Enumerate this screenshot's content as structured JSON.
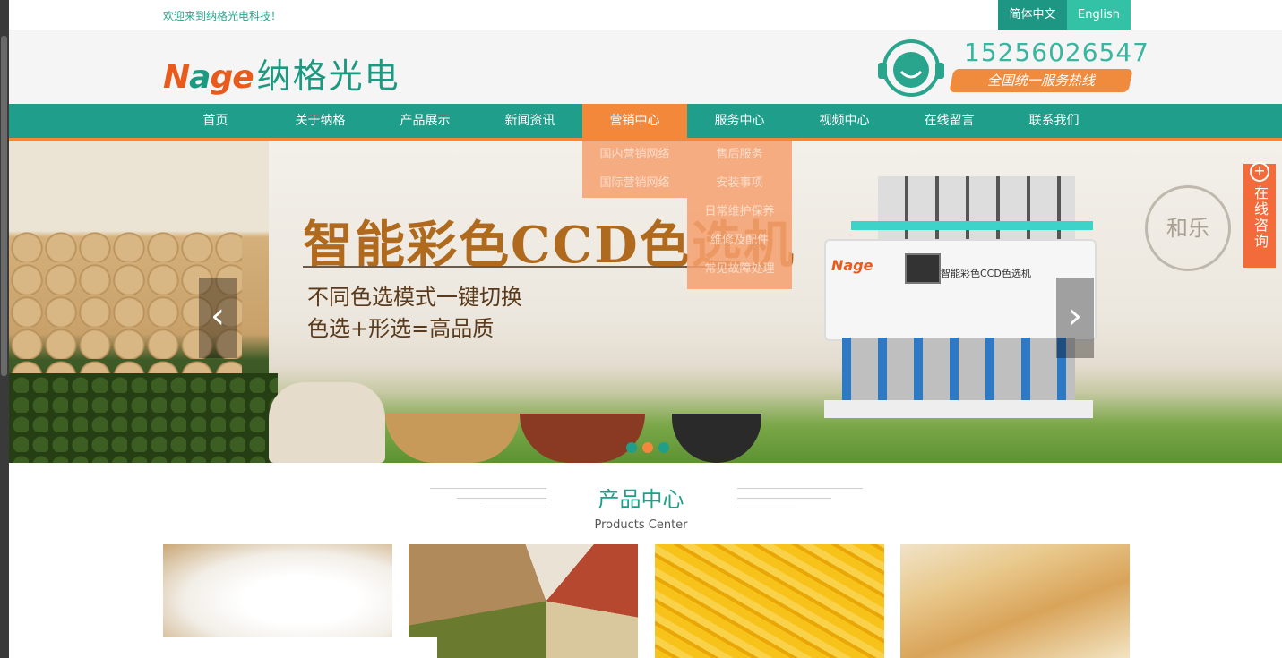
{
  "topbar": {
    "welcome": "欢迎来到纳格光电科技！",
    "lang_cn": "简体中文",
    "lang_en": "English"
  },
  "header": {
    "logo_en_n": "N",
    "logo_en_a": "a",
    "logo_en_ge": "ge",
    "logo_cn": "纳格光电",
    "phone": "15256026547",
    "hotline_label": "全国统一服务热线"
  },
  "nav": {
    "items": [
      {
        "label": "首页"
      },
      {
        "label": "关于纳格"
      },
      {
        "label": "产品展示"
      },
      {
        "label": "新闻资讯"
      },
      {
        "label": "营销中心"
      },
      {
        "label": "服务中心"
      },
      {
        "label": "视频中心"
      },
      {
        "label": "在线留言"
      },
      {
        "label": "联系我们"
      }
    ],
    "active_index": 4,
    "dropdown_marketing": [
      "国内营销网络",
      "国际营销网络"
    ],
    "dropdown_service": [
      "售后服务",
      "安装事项",
      "日常维护保养",
      "维修及配件",
      "常见故障处理"
    ]
  },
  "banner": {
    "headline": "智能彩色CCD色选机",
    "sub1": "不同色选模式一键切换",
    "sub2": "色选+形选=高品质",
    "machine_brand": "Nage",
    "machine_label": "智能彩色CCD色选机",
    "prev_arrow": "‹",
    "next_arrow": "›",
    "seal_text": "和乐",
    "dots": 3,
    "active_dot": 1
  },
  "consult": {
    "plus": "+",
    "label": "在线咨询"
  },
  "products_section": {
    "title": "产品中心",
    "subtitle": "Products Center"
  },
  "colors": {
    "primary": "#1f9f8b",
    "accent": "#f3873a",
    "consult": "#f36b3a"
  }
}
